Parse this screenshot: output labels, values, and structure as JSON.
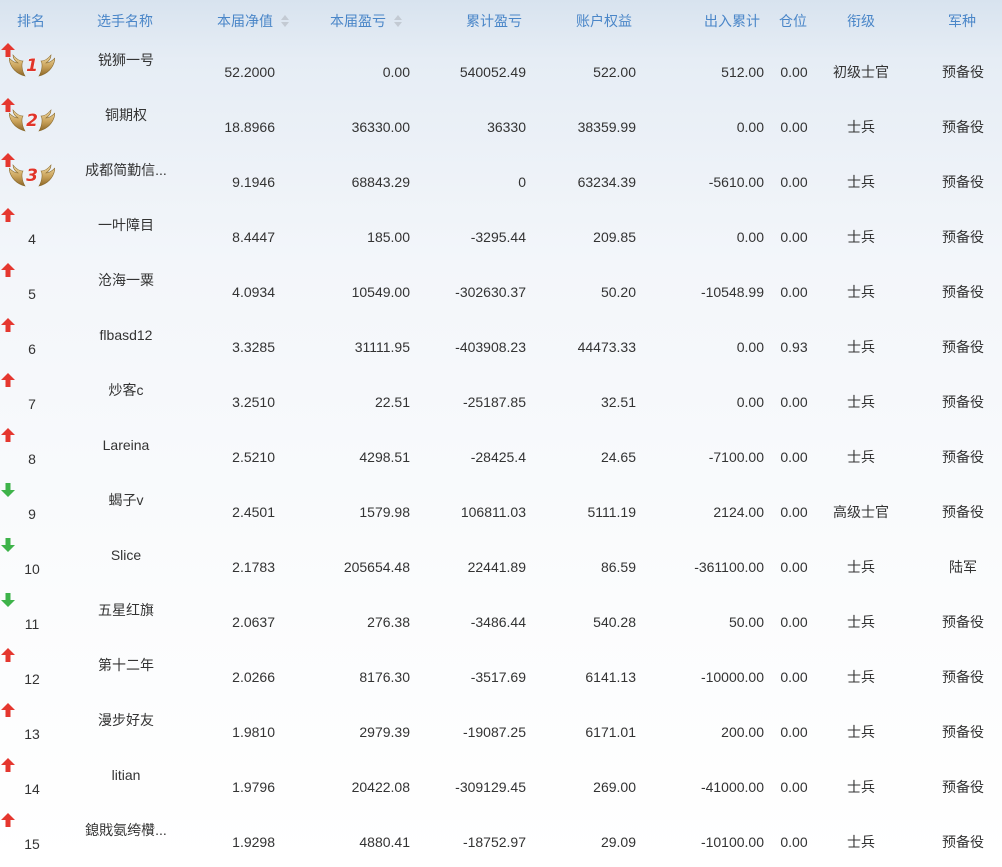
{
  "header": {
    "rank": "排名",
    "player": "选手名称",
    "nav": "本届净值",
    "pnl": "本届盈亏",
    "cum_pnl": "累计盈亏",
    "equity": "账户权益",
    "flow": "出入累计",
    "position": "仓位",
    "grade": "衔级",
    "arm": "军种"
  },
  "colors": {
    "header_text": "#4a86c8",
    "up_arrow": "#e5372f",
    "down_arrow": "#3eb34a",
    "medal_wing": "#c9a25a",
    "medal_number": "#e0352b"
  },
  "rows": [
    {
      "rank": "1",
      "medal": "1",
      "name": "锐狮一号",
      "nav": "52.2000",
      "trend": "up",
      "pnl": "0.00",
      "cum": "540052.49",
      "equity": "522.00",
      "flow": "512.00",
      "pos": "0.00",
      "grade": "初级士官",
      "arm": "预备役"
    },
    {
      "rank": "2",
      "medal": "2",
      "name": "铜期权",
      "nav": "18.8966",
      "trend": "up",
      "pnl": "36330.00",
      "cum": "36330",
      "equity": "38359.99",
      "flow": "0.00",
      "pos": "0.00",
      "grade": "士兵",
      "arm": "预备役"
    },
    {
      "rank": "3",
      "medal": "3",
      "name": "成都简勤信...",
      "nav": "9.1946",
      "trend": "up",
      "pnl": "68843.29",
      "cum": "0",
      "equity": "63234.39",
      "flow": "-5610.00",
      "pos": "0.00",
      "grade": "士兵",
      "arm": "预备役"
    },
    {
      "rank": "4",
      "medal": "",
      "name": "一叶障目",
      "nav": "8.4447",
      "trend": "up",
      "pnl": "185.00",
      "cum": "-3295.44",
      "equity": "209.85",
      "flow": "0.00",
      "pos": "0.00",
      "grade": "士兵",
      "arm": "预备役"
    },
    {
      "rank": "5",
      "medal": "",
      "name": "沧海一粟",
      "nav": "4.0934",
      "trend": "up",
      "pnl": "10549.00",
      "cum": "-302630.37",
      "equity": "50.20",
      "flow": "-10548.99",
      "pos": "0.00",
      "grade": "士兵",
      "arm": "预备役"
    },
    {
      "rank": "6",
      "medal": "",
      "name": "flbasd12",
      "nav": "3.3285",
      "trend": "up",
      "pnl": "31111.95",
      "cum": "-403908.23",
      "equity": "44473.33",
      "flow": "0.00",
      "pos": "0.93",
      "grade": "士兵",
      "arm": "预备役"
    },
    {
      "rank": "7",
      "medal": "",
      "name": "炒客c",
      "nav": "3.2510",
      "trend": "up",
      "pnl": "22.51",
      "cum": "-25187.85",
      "equity": "32.51",
      "flow": "0.00",
      "pos": "0.00",
      "grade": "士兵",
      "arm": "预备役"
    },
    {
      "rank": "8",
      "medal": "",
      "name": "Lareina",
      "nav": "2.5210",
      "trend": "up",
      "pnl": "4298.51",
      "cum": "-28425.4",
      "equity": "24.65",
      "flow": "-7100.00",
      "pos": "0.00",
      "grade": "士兵",
      "arm": "预备役"
    },
    {
      "rank": "9",
      "medal": "",
      "name": "蝎子v",
      "nav": "2.4501",
      "trend": "down",
      "pnl": "1579.98",
      "cum": "106811.03",
      "equity": "5111.19",
      "flow": "2124.00",
      "pos": "0.00",
      "grade": "高级士官",
      "arm": "预备役"
    },
    {
      "rank": "10",
      "medal": "",
      "name": "Slice",
      "nav": "2.1783",
      "trend": "down",
      "pnl": "205654.48",
      "cum": "22441.89",
      "equity": "86.59",
      "flow": "-361100.00",
      "pos": "0.00",
      "grade": "士兵",
      "arm": "陆军"
    },
    {
      "rank": "11",
      "medal": "",
      "name": "五星红旗",
      "nav": "2.0637",
      "trend": "down",
      "pnl": "276.38",
      "cum": "-3486.44",
      "equity": "540.28",
      "flow": "50.00",
      "pos": "0.00",
      "grade": "士兵",
      "arm": "预备役"
    },
    {
      "rank": "12",
      "medal": "",
      "name": "第十二年",
      "nav": "2.0266",
      "trend": "up",
      "pnl": "8176.30",
      "cum": "-3517.69",
      "equity": "6141.13",
      "flow": "-10000.00",
      "pos": "0.00",
      "grade": "士兵",
      "arm": "预备役"
    },
    {
      "rank": "13",
      "medal": "",
      "name": "漫步好友",
      "nav": "1.9810",
      "trend": "up",
      "pnl": "2979.39",
      "cum": "-19087.25",
      "equity": "6171.01",
      "flow": "200.00",
      "pos": "0.00",
      "grade": "士兵",
      "arm": "预备役"
    },
    {
      "rank": "14",
      "medal": "",
      "name": "litian",
      "nav": "1.9796",
      "trend": "up",
      "pnl": "20422.08",
      "cum": "-309129.45",
      "equity": "269.00",
      "flow": "-41000.00",
      "pos": "0.00",
      "grade": "士兵",
      "arm": "预备役"
    },
    {
      "rank": "15",
      "medal": "",
      "name": "鎴戝氨绔欑...",
      "nav": "1.9298",
      "trend": "up",
      "pnl": "4880.41",
      "cum": "-18752.97",
      "equity": "29.09",
      "flow": "-10100.00",
      "pos": "0.00",
      "grade": "士兵",
      "arm": "预备役"
    }
  ]
}
